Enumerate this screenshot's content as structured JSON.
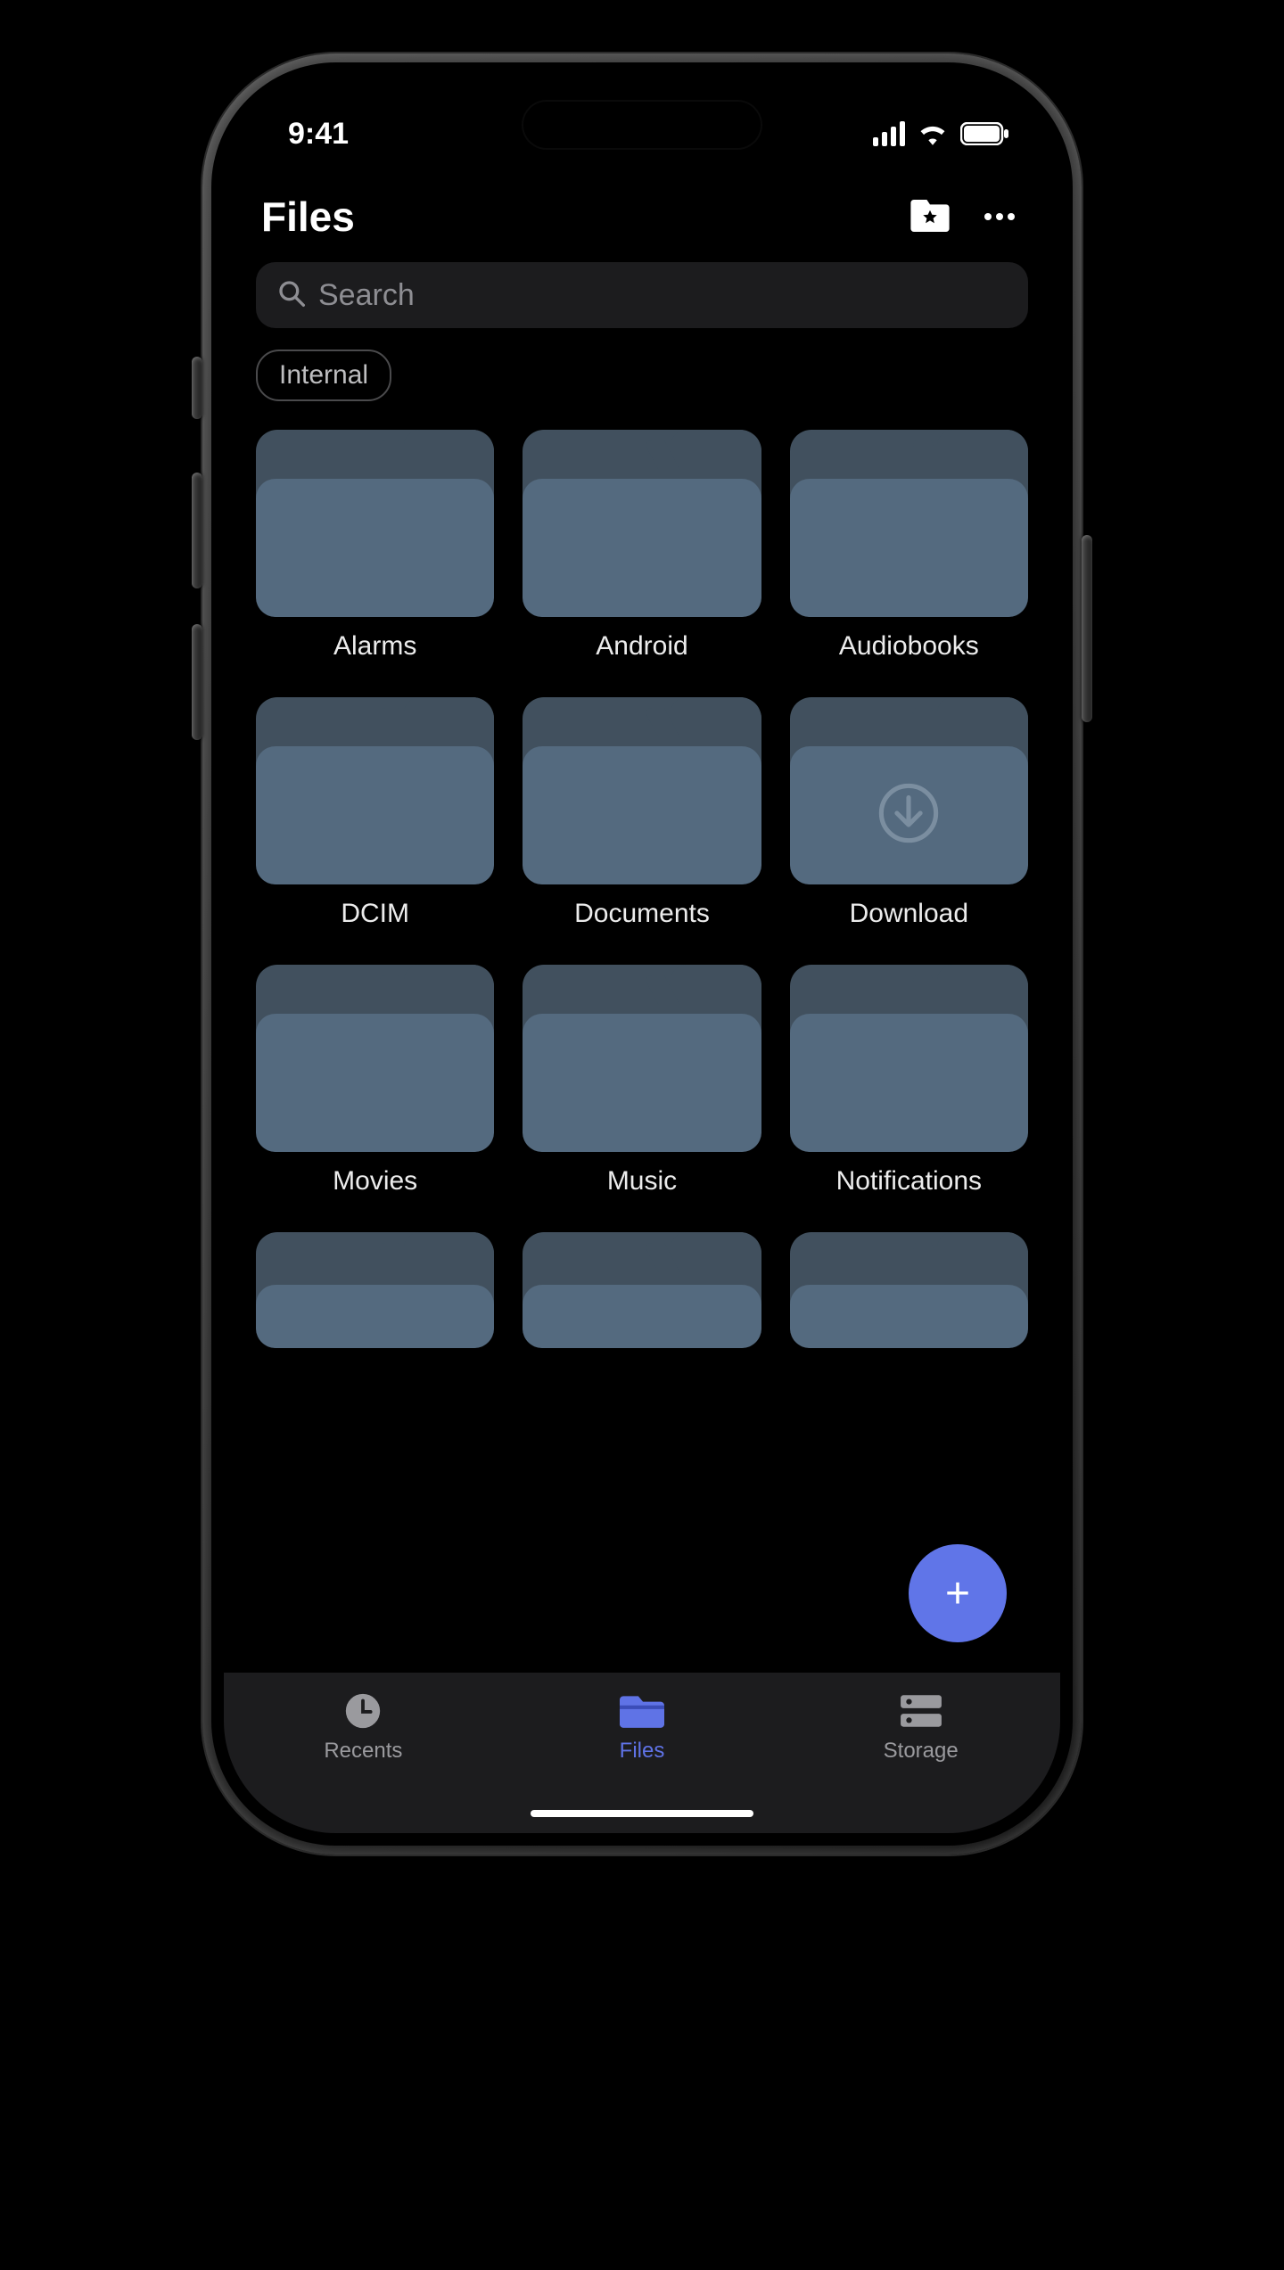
{
  "statusbar": {
    "time": "9:41"
  },
  "header": {
    "title": "Files",
    "favorites_icon": "folder-star-icon",
    "more_icon": "more-icon"
  },
  "search": {
    "placeholder": "Search"
  },
  "chips": [
    {
      "label": "Internal"
    }
  ],
  "folders": [
    {
      "label": "Alarms"
    },
    {
      "label": "Android"
    },
    {
      "label": "Audiobooks"
    },
    {
      "label": "DCIM"
    },
    {
      "label": "Documents"
    },
    {
      "label": "Download",
      "icon": "download"
    },
    {
      "label": "Movies"
    },
    {
      "label": "Music"
    },
    {
      "label": "Notifications"
    }
  ],
  "fab": {
    "label": "+"
  },
  "tabs": [
    {
      "label": "Recents",
      "icon": "clock",
      "active": false
    },
    {
      "label": "Files",
      "icon": "folder",
      "active": true
    },
    {
      "label": "Storage",
      "icon": "storage",
      "active": false
    }
  ],
  "colors": {
    "accent": "#6075e8",
    "folder_front": "#546a7f",
    "folder_back": "#41505e"
  }
}
